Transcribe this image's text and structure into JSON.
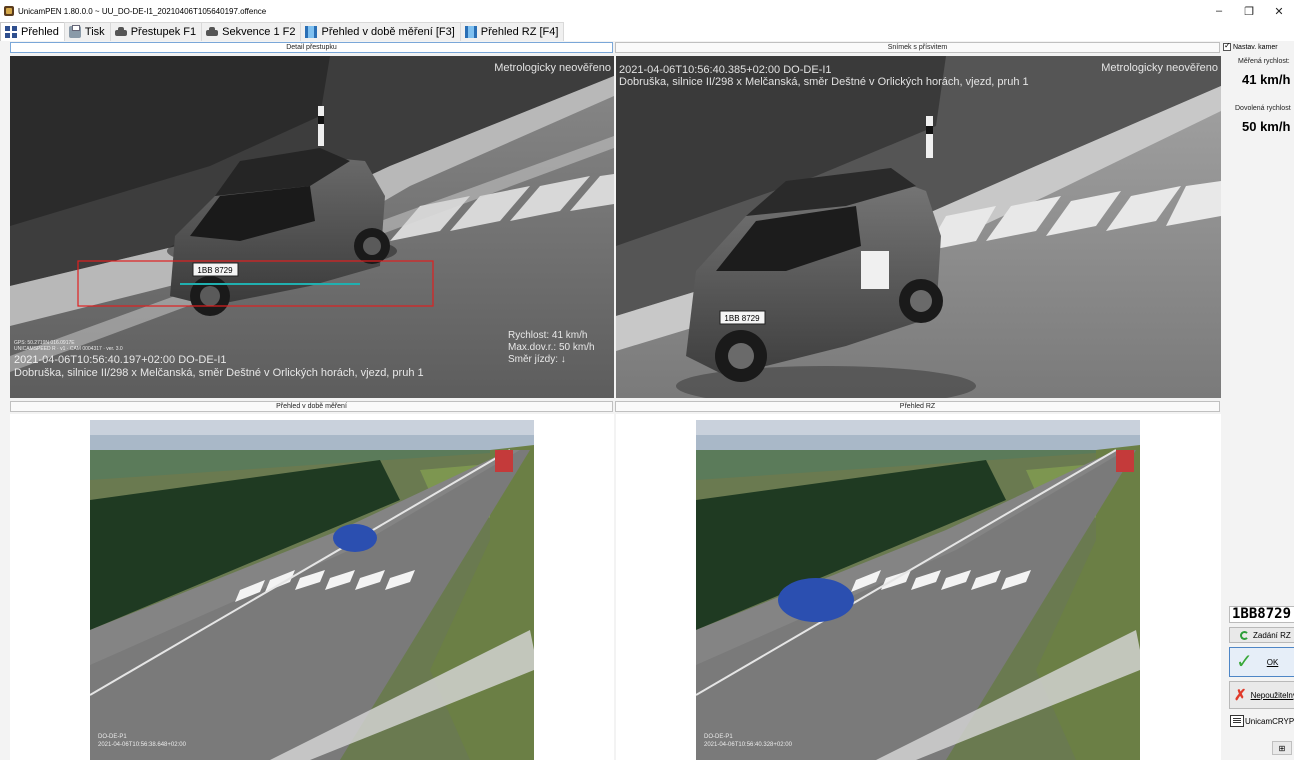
{
  "window": {
    "title": "UnicamPEN 1.80.0.0 ~ UU_DO-DE-I1_20210406T105640197.offence",
    "minimize": "–",
    "restore": "❐",
    "close": "✕"
  },
  "tabs": [
    {
      "label": "Přehled",
      "icon": "grid-icon"
    },
    {
      "label": "Tisk",
      "icon": "printer-icon"
    },
    {
      "label": "Přestupek F1",
      "icon": "car-icon"
    },
    {
      "label": "Sekvence 1 F2",
      "icon": "car-icon"
    },
    {
      "label": "Přehled v době měření [F3]",
      "icon": "film-icon"
    },
    {
      "label": "Přehled RZ [F4]",
      "icon": "film-icon"
    }
  ],
  "panels": {
    "detail": {
      "header": "Detail přestupku",
      "watermark": "Metrologicky neověřeno",
      "plate_text": "1BB 8729",
      "gps_line1": "GPS: 50.2719N 016.0917E",
      "gps_line2": "UNICAMSPEED R · v1 · CAM 0004317 · ver. 3.0",
      "timestamp": "2021-04-06T10:56:40.197+02:00 DO-DE-I1",
      "location": "Dobruška, silnice II/298 x Melčanská, směr Deštné v Orlických horách, vjezd, pruh 1",
      "speed_line": "Rychlost: 41 km/h",
      "max_line": "Max.dov.r.: 50 km/h",
      "direction_line": "Směr jízdy: ↓"
    },
    "snapshot": {
      "header": "Snímek s přísvitem",
      "watermark": "Metrologicky neověřeno",
      "plate_text": "1BB 8729",
      "timestamp": "2021-04-06T10:56:40.385+02:00 DO-DE-I1",
      "location": "Dobruška, silnice II/298 x Melčanská, směr Deštné v Orlických horách, vjezd, pruh 1"
    },
    "overview": {
      "header": "Přehled v době měření",
      "stamp_line1": "DO-DE-P1",
      "stamp_line2": "2021-04-06T10:56:38.648+02:00"
    },
    "plate_overview": {
      "header": "Přehled RZ",
      "stamp_line1": "DO-DE-P1",
      "stamp_line2": "2021-04-06T10:56:40.328+02:00"
    }
  },
  "right_panel": {
    "camera_settings_label": "Nastav. kamer",
    "camera_settings_checked": true,
    "measured_speed_label": "Měřená rychlost:",
    "measured_speed_value": "41 km/h",
    "allowed_speed_label": "Dovolená rychlost",
    "allowed_speed_value": "50 km/h",
    "plate_value": "1BB8729",
    "enter_plate_button": "Zadání RZ",
    "ok_button": "OK",
    "unusable_button": "Nepoužitelný",
    "crypt_label": "UnicamCRYPT",
    "small_button": "⊞"
  }
}
